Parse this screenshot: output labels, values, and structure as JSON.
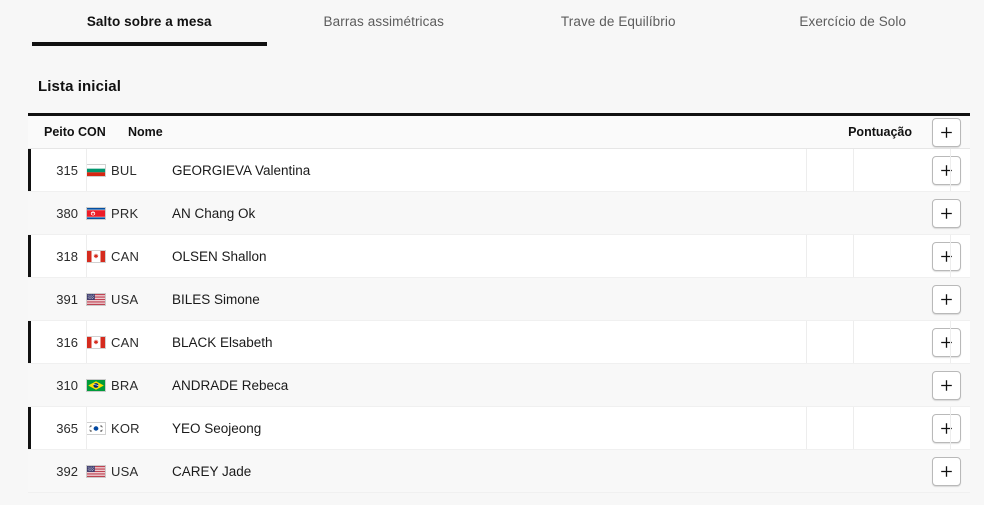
{
  "tabs": [
    {
      "label": "Salto sobre a mesa",
      "active": true
    },
    {
      "label": "Barras assimétricas",
      "active": false
    },
    {
      "label": "Trave de Equilíbrio",
      "active": false
    },
    {
      "label": "Exercício de Solo",
      "active": false
    }
  ],
  "section": {
    "title": "Lista inicial"
  },
  "table": {
    "columns": {
      "bib": "Peito CON",
      "name": "Nome",
      "score": "Pontuação",
      "add_button": "+"
    },
    "rows": [
      {
        "bib": "315",
        "noc": "BUL",
        "flag": "bulgaria-flag",
        "name": "GEORGIEVA Valentina",
        "score": "",
        "add_button": "+"
      },
      {
        "bib": "380",
        "noc": "PRK",
        "flag": "north-korea-flag",
        "name": "AN Chang Ok",
        "score": "",
        "add_button": "+"
      },
      {
        "bib": "318",
        "noc": "CAN",
        "flag": "canada-flag",
        "name": "OLSEN Shallon",
        "score": "",
        "add_button": "+"
      },
      {
        "bib": "391",
        "noc": "USA",
        "flag": "usa-flag",
        "name": "BILES Simone",
        "score": "",
        "add_button": "+"
      },
      {
        "bib": "316",
        "noc": "CAN",
        "flag": "canada-flag",
        "name": "BLACK Elsabeth",
        "score": "",
        "add_button": "+"
      },
      {
        "bib": "310",
        "noc": "BRA",
        "flag": "brazil-flag",
        "name": "ANDRADE Rebeca",
        "score": "",
        "add_button": "+"
      },
      {
        "bib": "365",
        "noc": "KOR",
        "flag": "south-korea-flag",
        "name": "YEO Seojeong",
        "score": "",
        "add_button": "+"
      },
      {
        "bib": "392",
        "noc": "USA",
        "flag": "usa-flag",
        "name": "CAREY Jade",
        "score": "",
        "add_button": "+"
      }
    ]
  },
  "colors": {
    "accent": "#111111",
    "page_background": "#f7f7f7",
    "row_alt_background": "#f8f8f8"
  }
}
